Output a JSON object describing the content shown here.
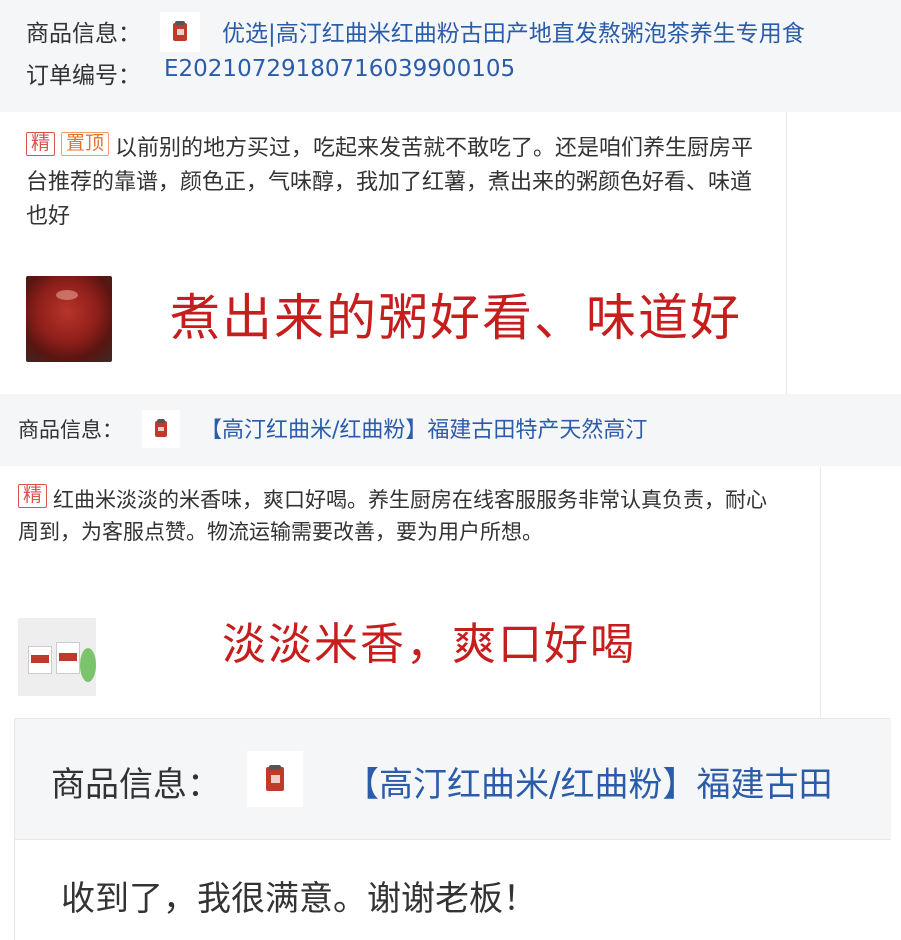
{
  "block1": {
    "product_label": "商品信息：",
    "product_title": "优选|高汀红曲米红曲粉古田产地直发熬粥泡茶养生专用食",
    "order_label": "订单编号：",
    "order_number": "E20210729180716039900105"
  },
  "review1": {
    "tags": [
      "精",
      "置顶"
    ],
    "text": "以前别的地方买过，吃起来发苦就不敢吃了。还是咱们养生厨房平台推荐的靠谱，颜色正，气味醇，我加了红薯，煮出来的粥颜色好看、味道也好",
    "overlay": "煮出来的粥好看、味道好"
  },
  "block2": {
    "product_label": "商品信息：",
    "product_title": "【高汀红曲米/红曲粉】福建古田特产天然高汀"
  },
  "review2": {
    "tags": [
      "精"
    ],
    "text": "红曲米淡淡的米香味，爽口好喝。养生厨房在线客服服务非常认真负责，耐心周到，为客服点赞。物流运输需要改善，要为用户所想。",
    "overlay": "淡淡米香，爽口好喝"
  },
  "block3": {
    "product_label": "商品信息：",
    "product_title": "【高汀红曲米/红曲粉】福建古田"
  },
  "review3": {
    "text": "收到了，我很满意。谢谢老板！"
  },
  "colors": {
    "accent_link": "#2a5caa",
    "overlay_red": "#c61d1d",
    "tag_red": "#d9534f",
    "tag_orange": "#e5732a",
    "info_bg": "#f5f6f8"
  },
  "icons": {
    "product_thumb": "product-jar-icon",
    "review1_photo": "porridge-photo",
    "review2_photo": "jars-photo"
  }
}
